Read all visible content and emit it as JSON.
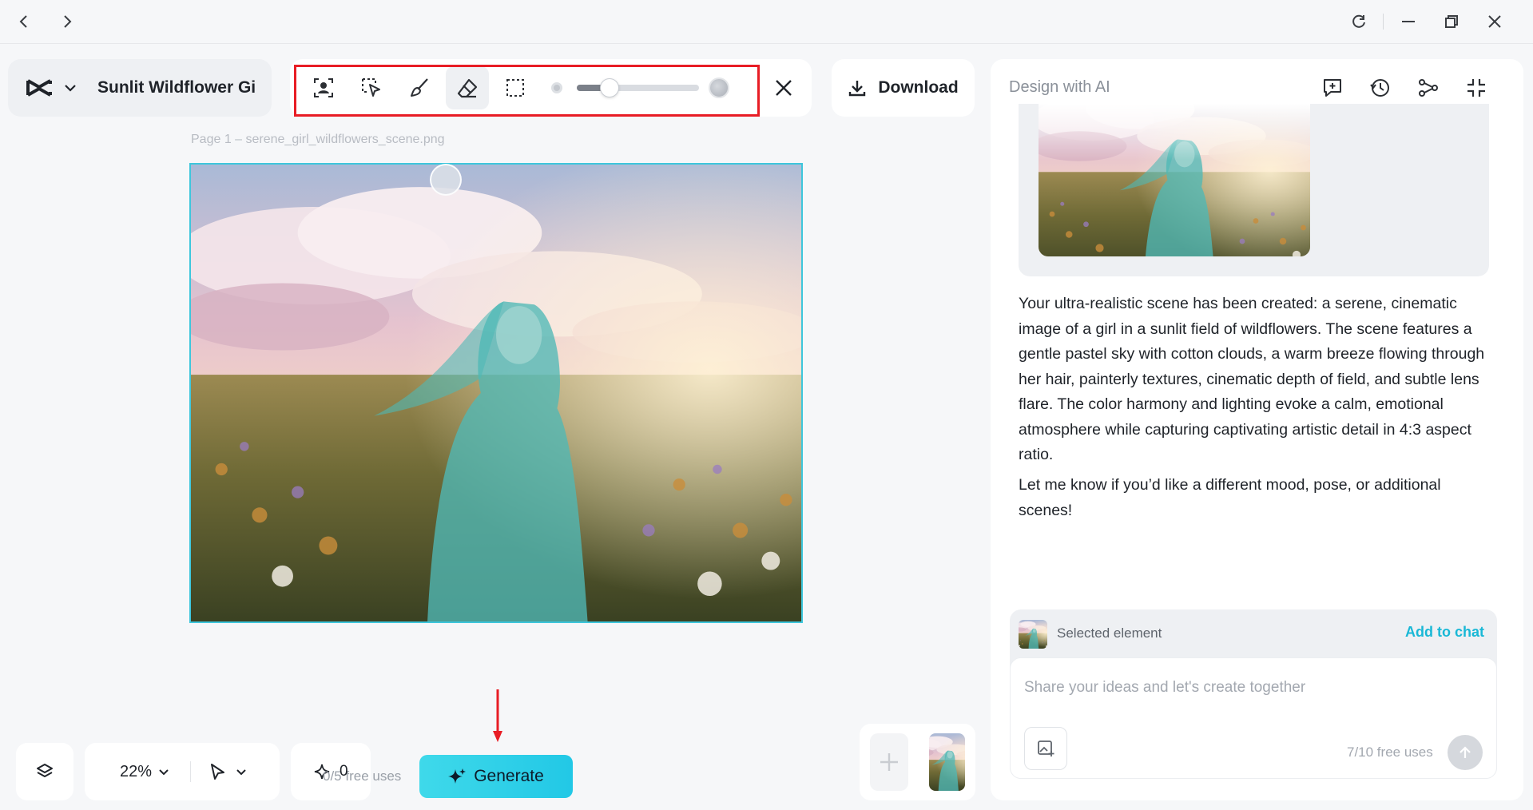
{
  "window": {
    "back_icon": "chevron-left-icon",
    "forward_icon": "chevron-right-icon",
    "controls": [
      "refresh-icon",
      "minimize-icon",
      "restore-icon",
      "close-icon"
    ]
  },
  "project": {
    "title": "Sunlit Wildflower Gi",
    "logo_icon": "capcut-logo-icon"
  },
  "toolbar": {
    "tools": [
      "select-subject-icon",
      "smart-select-icon",
      "brush-icon",
      "eraser-icon",
      "rect-select-icon"
    ],
    "active_tool": "eraser-icon",
    "brush_size_fraction": 0.3,
    "close_icon": "close-icon"
  },
  "download": {
    "label": "Download"
  },
  "canvas": {
    "page_label": "Page 1 –   serene_girl_wildflowers_scene.png"
  },
  "bottom_controls": {
    "zoom": "22%",
    "credit_count": "0",
    "free_uses": "0/5 free uses",
    "generate_label": "Generate"
  },
  "panel": {
    "title": "Design with AI",
    "header_icons": [
      "new-chat-icon",
      "history-icon",
      "share-icon",
      "collapse-icon"
    ],
    "message_p1": "Your ultra-realistic scene has been created: a serene, cinematic image of a girl in a sunlit field of wildflowers. The scene features a gentle pastel sky with cotton clouds, a warm breeze flowing through her hair, painterly textures, cinematic depth of field, and subtle lens flare. The color harmony and lighting evoke a calm, emotional atmosphere while capturing captivating artistic detail in 4:3 aspect ratio.",
    "message_p2": "Let me know if you’d like a different mood, pose, or additional scenes!",
    "selected_label": "Selected element",
    "add_to_chat": "Add to chat",
    "input_placeholder": "Share your ideas and let's create together",
    "free_uses": "7/10 free uses"
  },
  "colors": {
    "accent": "#22c8e6",
    "highlight_box": "#e81d25",
    "selection_border": "#3ec6dc"
  }
}
